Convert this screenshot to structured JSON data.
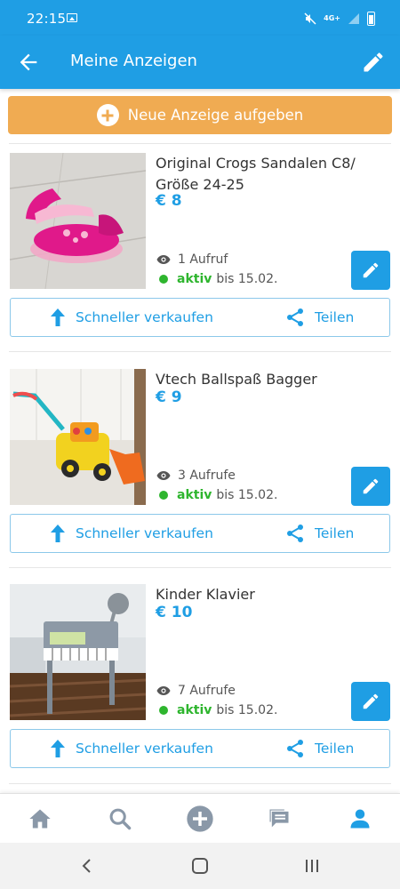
{
  "status_bar": {
    "time": "22:15",
    "network": "4G+"
  },
  "header": {
    "title": "Meine Anzeigen",
    "back_icon": "arrow-left-icon",
    "edit_icon": "pencil-icon"
  },
  "new_ad_button": {
    "label": "Neue Anzeige aufgeben"
  },
  "listings": [
    {
      "title": "Original Crogs Sandalen C8/ Größe 24-25",
      "price": "€ 8",
      "views": "1 Aufruf",
      "status": "aktiv",
      "until": "bis 15.02.",
      "sell_label": "Schneller verkaufen",
      "share_label": "Teilen"
    },
    {
      "title": "Vtech Ballspaß Bagger",
      "price": "€ 9",
      "views": "3 Aufrufe",
      "status": "aktiv",
      "until": "bis 15.02.",
      "sell_label": "Schneller verkaufen",
      "share_label": "Teilen"
    },
    {
      "title": "Kinder Klavier",
      "price": "€ 10",
      "views": "7 Aufrufe",
      "status": "aktiv",
      "until": "bis 15.02.",
      "sell_label": "Schneller verkaufen",
      "share_label": "Teilen"
    }
  ],
  "bottom_nav": [
    "home-icon",
    "search-icon",
    "add-circle-icon",
    "messages-icon",
    "profile-icon"
  ],
  "colors": {
    "primary": "#1f9ee4",
    "accent": "#f0ab52",
    "active": "#2eb52e"
  }
}
